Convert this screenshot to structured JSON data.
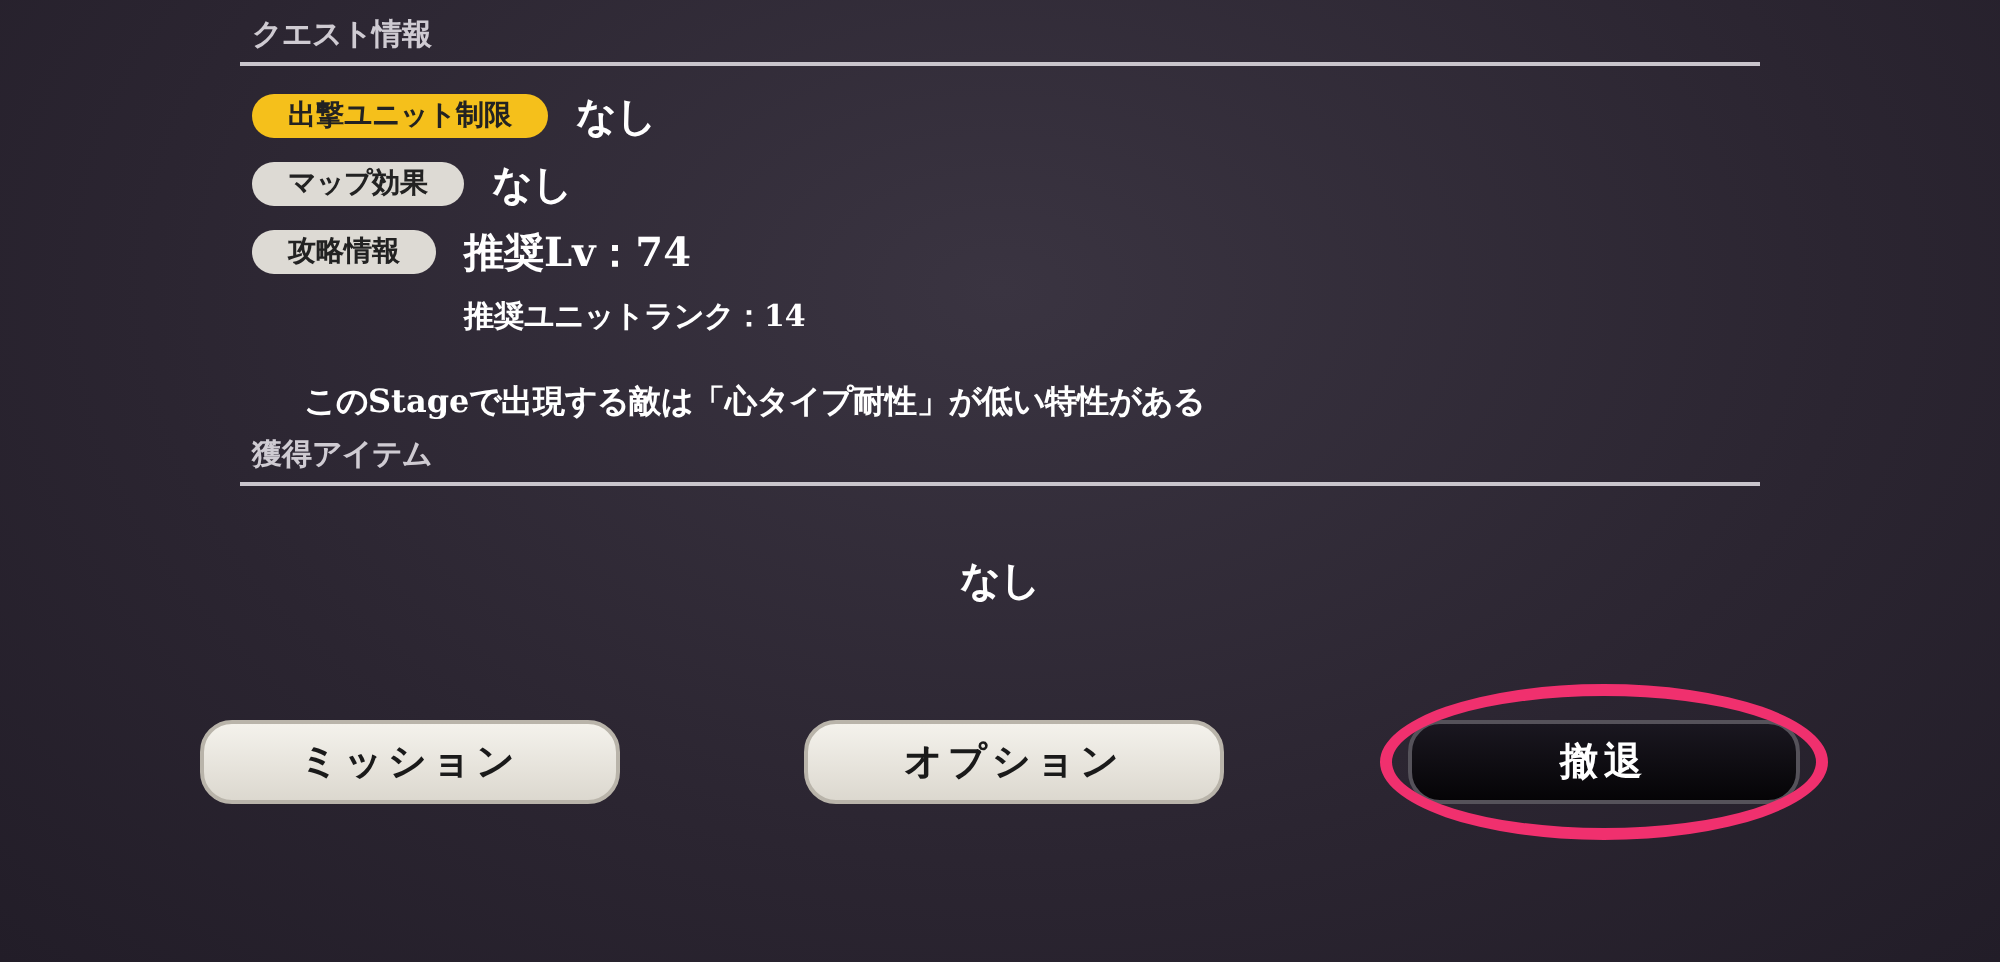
{
  "quest_info": {
    "title": "クエスト情報",
    "rows": [
      {
        "label": "出撃ユニット制限",
        "kind": "accent",
        "values": [
          "なし"
        ]
      },
      {
        "label": "マップ効果",
        "kind": "plain",
        "values": [
          "なし"
        ]
      },
      {
        "label": "攻略情報",
        "kind": "plain",
        "values": [
          "推奨Lv：74",
          "推奨ユニットランク：14"
        ]
      }
    ],
    "note": "このStageで出現する敵は「心タイプ耐性」が低い特性がある"
  },
  "rewards": {
    "title": "獲得アイテム",
    "value": "なし"
  },
  "buttons": [
    {
      "label": "ミッション",
      "kind": "light",
      "highlighted": false
    },
    {
      "label": "オプション",
      "kind": "light",
      "highlighted": false
    },
    {
      "label": "撤退",
      "kind": "dark",
      "highlighted": true
    }
  ]
}
